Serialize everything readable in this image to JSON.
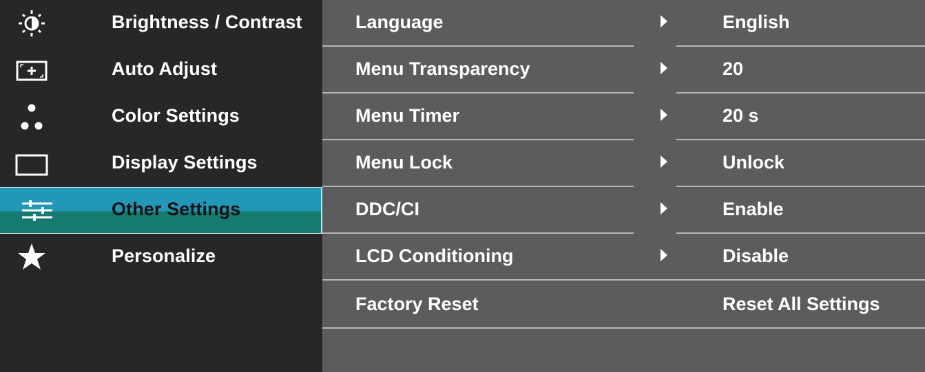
{
  "sidebar": {
    "items": [
      {
        "label": "Brightness / Contrast",
        "icon": "brightness-icon"
      },
      {
        "label": "Auto Adjust",
        "icon": "auto-adjust-icon"
      },
      {
        "label": "Color Settings",
        "icon": "color-settings-icon"
      },
      {
        "label": "Display Settings",
        "icon": "display-settings-icon"
      },
      {
        "label": "Other Settings",
        "icon": "other-settings-icon",
        "selected": true
      },
      {
        "label": "Personalize",
        "icon": "star-icon"
      }
    ]
  },
  "panel": {
    "rows": [
      {
        "label": "Language",
        "value": "English",
        "has_arrow": true
      },
      {
        "label": "Menu Transparency",
        "value": "20",
        "has_arrow": true
      },
      {
        "label": "Menu Timer",
        "value": "20 s",
        "has_arrow": true
      },
      {
        "label": "Menu Lock",
        "value": "Unlock",
        "has_arrow": true
      },
      {
        "label": "DDC/CI",
        "value": "Enable",
        "has_arrow": true
      },
      {
        "label": "LCD Conditioning",
        "value": "Disable",
        "has_arrow": true
      },
      {
        "label": "Factory Reset",
        "value": "Reset All Settings",
        "has_arrow": false
      }
    ]
  },
  "colors": {
    "sidebar_bg": "#262727",
    "panel_bg": "#5c5c5c",
    "selected_top": "#2397b8",
    "selected_bottom": "#177a70",
    "divider": "#b6b6b6",
    "text": "#ffffff"
  }
}
